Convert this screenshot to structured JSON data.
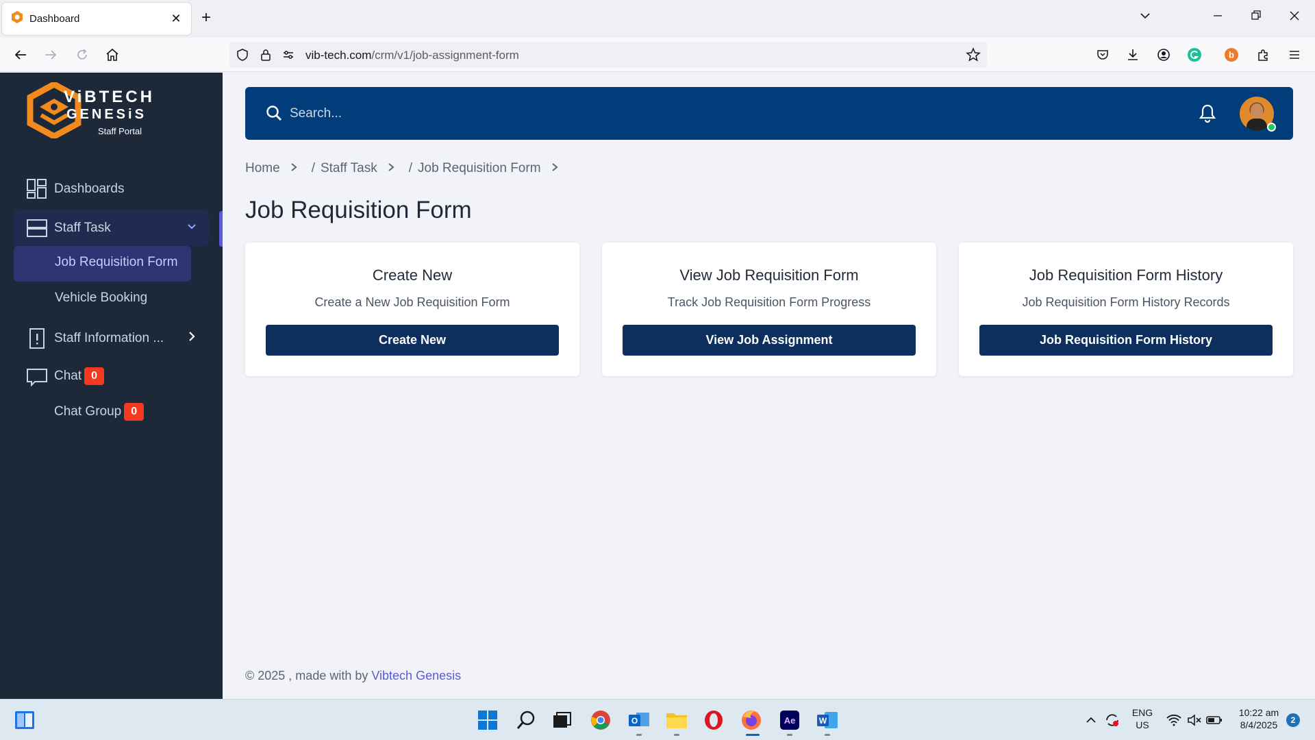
{
  "browser": {
    "tab_title": "Dashboard",
    "tab_close": "✕",
    "new_tab": "+",
    "url_domain": "vib-tech.com",
    "url_path": "/crm/v1/job-assignment-form",
    "accent": "#f28a1e"
  },
  "sidebar": {
    "brand_line1": "ViBTECH",
    "brand_line2": "GENESiS",
    "brand_sub": "Staff Portal",
    "items": [
      {
        "label": "Dashboards",
        "icon": "grid-icon"
      },
      {
        "label": "Staff Task",
        "icon": "tray-icon"
      },
      {
        "label": "Job Requisition Form"
      },
      {
        "label": "Vehicle Booking"
      },
      {
        "label": "Staff Information ...",
        "icon": "info-icon"
      },
      {
        "label": "Chat",
        "icon": "chat-icon",
        "badge": "0"
      },
      {
        "label": "Chat Group",
        "badge": "0"
      }
    ],
    "bg": "#1d2838",
    "active_bg": "#2c3572"
  },
  "header": {
    "search_placeholder": "Search...",
    "bg": "#003d7a"
  },
  "breadcrumb": [
    "Home",
    "Staff Task",
    "Job Requisition Form"
  ],
  "breadcrumb_sep": "/",
  "page_title": "Job Requisition Form",
  "cards": [
    {
      "title": "Create New",
      "desc": "Create a New Job Requisition Form",
      "button": "Create New"
    },
    {
      "title": "View Job Requisition Form",
      "desc": "Track Job Requisition Form Progress",
      "button": "View Job Assignment"
    },
    {
      "title": "Job Requisition Form History",
      "desc": "Job Requisition Form History Records",
      "button": "Job Requisition Form History"
    }
  ],
  "footer": {
    "text": "© 2025 , made with by ",
    "brand": "Vibtech Genesis"
  },
  "taskbar": {
    "lang1": "ENG",
    "lang2": "US",
    "time": "10:22 am",
    "date": "8/4/2025",
    "notifications": "2"
  }
}
